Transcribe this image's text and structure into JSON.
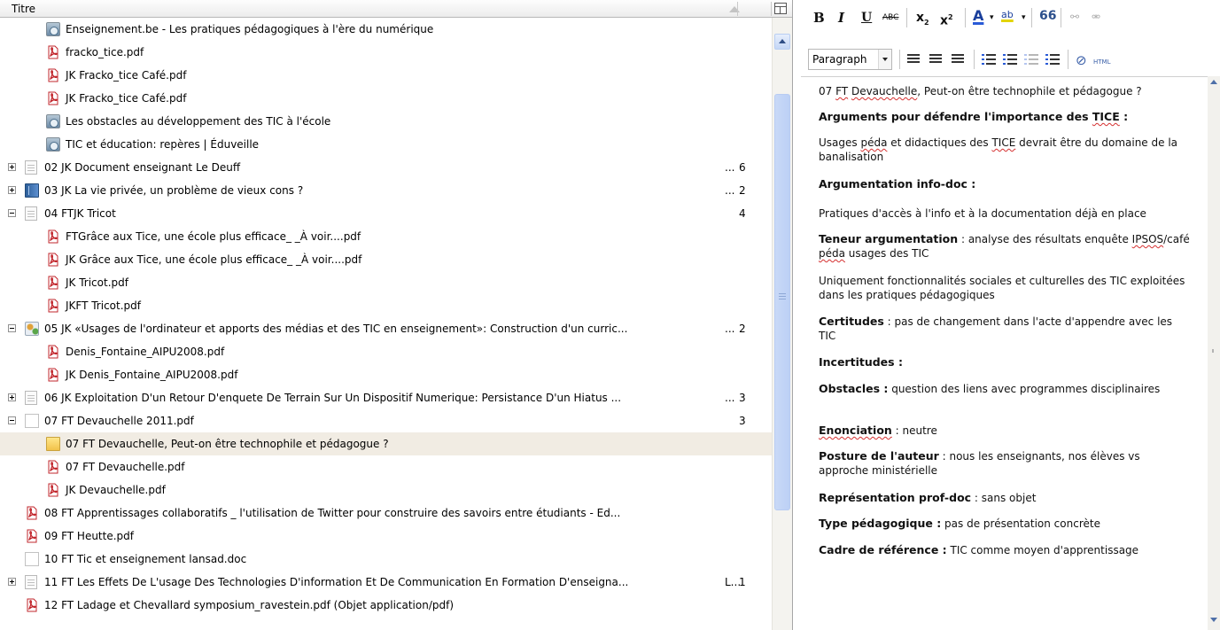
{
  "tree": {
    "column_title": "Titre",
    "rows": [
      {
        "depth": 1,
        "icon": "web-page-icon",
        "title": "Enseignement.be - Les pratiques pédagogiques à l'ère du numérique",
        "count": "",
        "twisty": ""
      },
      {
        "depth": 1,
        "icon": "pdf-icon",
        "title": "fracko_tice.pdf",
        "count": "",
        "twisty": ""
      },
      {
        "depth": 1,
        "icon": "pdf-icon",
        "title": "JK Fracko_tice Café.pdf",
        "count": "",
        "twisty": ""
      },
      {
        "depth": 1,
        "icon": "pdf-icon",
        "title": "JK Fracko_tice Café.pdf",
        "count": "",
        "twisty": ""
      },
      {
        "depth": 1,
        "icon": "web-page-icon",
        "title": "Les obstacles au développement des TIC à l'école",
        "count": "",
        "twisty": ""
      },
      {
        "depth": 1,
        "icon": "web-page-icon",
        "title": "TIC et éducation: repères | Éduveille",
        "count": "",
        "twisty": ""
      },
      {
        "depth": 0,
        "icon": "document-icon",
        "title": "02 JK Document enseignant Le Deuff",
        "count": "6",
        "ellipsis": "...",
        "twisty": "plus"
      },
      {
        "depth": 0,
        "icon": "book-icon",
        "title": "03 JK La vie privée, un problème de vieux cons ?",
        "count": "2",
        "ellipsis": "...",
        "twisty": "plus"
      },
      {
        "depth": 0,
        "icon": "document-icon",
        "title": "04 FTJK Tricot",
        "count": "4",
        "twisty": "minus"
      },
      {
        "depth": 1,
        "icon": "pdf-icon",
        "title": "FTGrâce aux Tice, une école plus efficace_ _À voir....pdf",
        "count": "",
        "twisty": ""
      },
      {
        "depth": 1,
        "icon": "pdf-icon",
        "title": "JK Grâce aux Tice, une école plus efficace_ _À voir....pdf",
        "count": "",
        "twisty": ""
      },
      {
        "depth": 1,
        "icon": "pdf-icon",
        "title": "JK Tricot.pdf",
        "count": "",
        "twisty": ""
      },
      {
        "depth": 1,
        "icon": "pdf-icon",
        "title": "JKFT Tricot.pdf",
        "count": "",
        "twisty": ""
      },
      {
        "depth": 0,
        "icon": "multimedia-icon",
        "title": "05 JK «Usages de l'ordinateur et apports des médias et des TIC en enseignement»: Construction d'un curric...",
        "count": "2",
        "ellipsis": "...",
        "twisty": "minus"
      },
      {
        "depth": 1,
        "icon": "pdf-icon",
        "title": "Denis_Fontaine_AIPU2008.pdf",
        "count": "",
        "twisty": ""
      },
      {
        "depth": 1,
        "icon": "pdf-icon",
        "title": "JK Denis_Fontaine_AIPU2008.pdf",
        "count": "",
        "twisty": ""
      },
      {
        "depth": 0,
        "icon": "document-icon",
        "title": "06 JK  Exploitation D'un Retour D'enquete De Terrain Sur Un Dispositif Numerique: Persistance D'un Hiatus ...",
        "count": "3",
        "ellipsis": "...",
        "twisty": "plus"
      },
      {
        "depth": 0,
        "icon": "blank-document-icon",
        "title": "07 FT Devauchelle 2011.pdf",
        "count": "3",
        "twisty": "minus"
      },
      {
        "depth": 1,
        "icon": "note-icon",
        "title": "07 FT Devauchelle, Peut-on être technophile et pédagogue ?",
        "count": "",
        "twisty": "",
        "selected": true
      },
      {
        "depth": 1,
        "icon": "pdf-icon",
        "title": "07 FT Devauchelle.pdf",
        "count": "",
        "twisty": ""
      },
      {
        "depth": 1,
        "icon": "pdf-icon",
        "title": "JK Devauchelle.pdf",
        "count": "",
        "twisty": ""
      },
      {
        "depth": 0,
        "icon": "pdf-icon",
        "title": "08 FT Apprentissages collaboratifs _ l'utilisation de Twitter pour construire des savoirs entre étudiants - Ed...",
        "count": "",
        "twisty": ""
      },
      {
        "depth": 0,
        "icon": "pdf-icon",
        "title": "09 FT Heutte.pdf",
        "count": "",
        "twisty": ""
      },
      {
        "depth": 0,
        "icon": "blank-document-icon",
        "title": "10 FT Tic et enseignement lansad.doc",
        "count": "",
        "twisty": ""
      },
      {
        "depth": 0,
        "icon": "document-icon",
        "title": "11 FT Les Effets De L'usage Des Technologies D'information Et De Communication En Formation D'enseigna...",
        "count": "1",
        "ellipsis": "L...",
        "twisty": "plus"
      },
      {
        "depth": 0,
        "icon": "pdf-icon",
        "title": "12 FT Ladage et Chevallard symposium_ravestein.pdf (Objet application/pdf)",
        "count": "",
        "twisty": ""
      }
    ]
  },
  "toolbar": {
    "bold": "B",
    "italic": "I",
    "underline": "U",
    "strike": "ABC",
    "subscript": "x",
    "subscript_mark": "2",
    "superscript": "x",
    "superscript_mark": "2",
    "text_color": "A",
    "highlight": "ab",
    "blockquote": "66",
    "format_select": "Paragraph",
    "html": "HTML"
  },
  "note": {
    "paragraphs": [
      {
        "parts": [
          {
            "t": "07 ",
            "s": ""
          },
          {
            "t": "FT",
            "s": "sq"
          },
          {
            "t": " ",
            "s": ""
          },
          {
            "t": "Devauchelle",
            "s": "sq"
          },
          {
            "t": ", Peut-on être technophile et pédagogue ?",
            "s": ""
          }
        ]
      },
      {
        "parts": [
          {
            "t": "Arguments pour défendre l'importance des ",
            "s": "b"
          },
          {
            "t": "TICE",
            "s": "b sq"
          },
          {
            "t": " :",
            "s": "b"
          }
        ]
      },
      {
        "parts": [
          {
            "t": "Usages ",
            "s": ""
          },
          {
            "t": "péda",
            "s": "sq"
          },
          {
            "t": " et didactiques des ",
            "s": ""
          },
          {
            "t": "TICE",
            "s": "sq"
          },
          {
            "t": " devrait être du domaine de la banalisation",
            "s": ""
          }
        ]
      },
      {
        "parts": [
          {
            "t": "Argumentation info-doc :",
            "s": "b"
          }
        ]
      },
      {
        "parts": [
          {
            "t": "Pratiques d'accès à l'info et à la documentation déjà en place",
            "s": ""
          }
        ]
      },
      {
        "parts": [
          {
            "t": "Teneur argumentation",
            "s": "b"
          },
          {
            "t": " : analyse des résultats enquête ",
            "s": ""
          },
          {
            "t": "IPSOS",
            "s": "sq"
          },
          {
            "t": "/café ",
            "s": ""
          },
          {
            "t": "péda",
            "s": "sq"
          },
          {
            "t": " usages des TIC",
            "s": ""
          }
        ]
      },
      {
        "parts": [
          {
            "t": "Uniquement fonctionnalités sociales et culturelles des TIC exploitées dans les pratiques pédagogiques",
            "s": ""
          }
        ]
      },
      {
        "parts": [
          {
            "t": "Certitudes",
            "s": "b"
          },
          {
            "t": " : pas de changement dans l'acte d'appendre avec les TIC",
            "s": ""
          }
        ]
      },
      {
        "parts": [
          {
            "t": "Incertitudes :",
            "s": "b"
          }
        ]
      },
      {
        "parts": [
          {
            "t": "Obstacles :",
            "s": "b"
          },
          {
            "t": " question des liens avec programmes disciplinaires",
            "s": ""
          }
        ]
      },
      {
        "parts": [
          {
            "t": "Enonciation",
            "s": "b sq"
          },
          {
            "t": " : neutre",
            "s": ""
          }
        ]
      },
      {
        "parts": [
          {
            "t": "Posture de l'auteur",
            "s": "b"
          },
          {
            "t": " : nous les enseignants, nos élèves vs approche ministérielle",
            "s": ""
          }
        ]
      },
      {
        "parts": [
          {
            "t": "Représentation prof-doc",
            "s": "b"
          },
          {
            "t": " : sans objet",
            "s": ""
          }
        ]
      },
      {
        "parts": [
          {
            "t": "Type pédagogique :",
            "s": "b"
          },
          {
            "t": " pas de présentation concrète",
            "s": ""
          }
        ]
      },
      {
        "parts": [
          {
            "t": "Cadre de référence :",
            "s": "b"
          },
          {
            "t": " TIC comme moyen d'apprentissage",
            "s": ""
          }
        ]
      }
    ]
  }
}
